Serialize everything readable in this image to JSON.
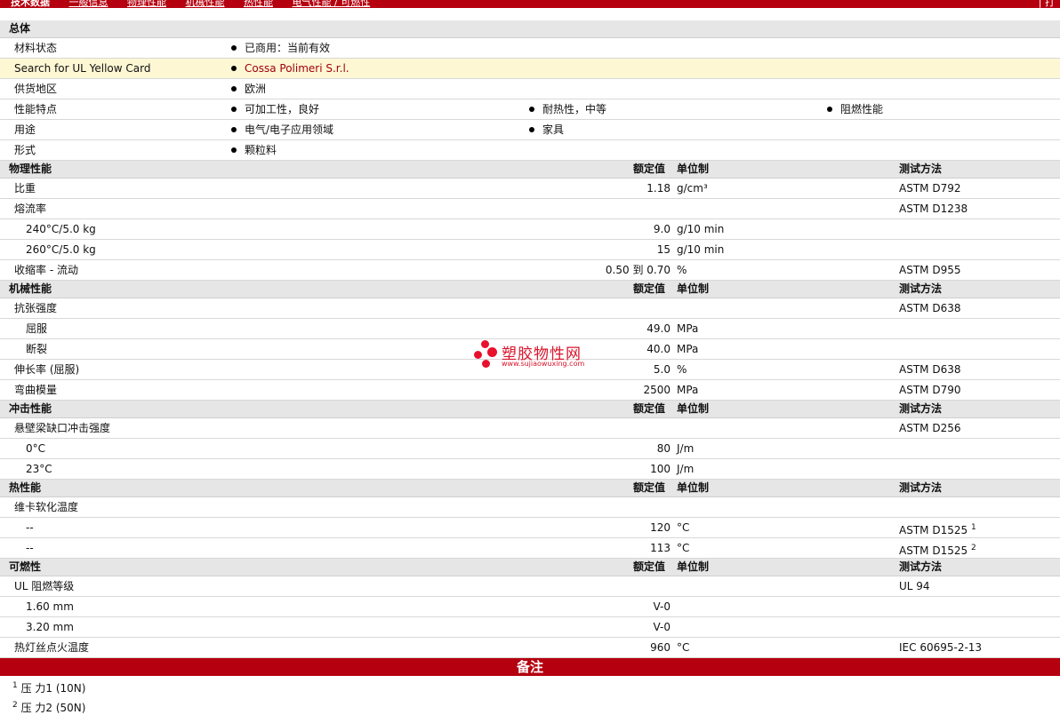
{
  "topnav": {
    "tabs": [
      "技术数据",
      "一般信息",
      "物理性能",
      "机械性能",
      "热性能",
      "电气性能 / 可燃性"
    ],
    "right": "| 打"
  },
  "general": {
    "title": "总体",
    "material_status": {
      "label": "材料状态",
      "value": "已商用：当前有效"
    },
    "yellow_card": {
      "label": "Search for UL Yellow Card",
      "value": "Cossa Polimeri S.r.l."
    },
    "region": {
      "label": "供货地区",
      "value": "欧洲"
    },
    "features": {
      "label": "性能特点",
      "values": [
        "可加工性，良好",
        "耐热性，中等",
        "阻燃性能"
      ]
    },
    "uses": {
      "label": "用途",
      "values": [
        "电气/电子应用领域",
        "家具"
      ]
    },
    "form": {
      "label": "形式",
      "value": "颗粒料"
    }
  },
  "col_headers": {
    "nominal": "额定值",
    "unit": "单位制",
    "test": "测试方法"
  },
  "physical": {
    "title": "物理性能",
    "rows": [
      {
        "label": "比重",
        "value": "1.18",
        "unit": "g/cm³",
        "test": "ASTM D792"
      },
      {
        "label": "熔流率",
        "value": "",
        "unit": "",
        "test": "ASTM D1238"
      },
      {
        "label": "240°C/5.0 kg",
        "value": "9.0",
        "unit": "g/10 min",
        "test": ""
      },
      {
        "label": "260°C/5.0 kg",
        "value": "15",
        "unit": "g/10 min",
        "test": ""
      },
      {
        "label": "收缩率  - 流动",
        "value": "0.50 到  0.70",
        "unit": "%",
        "test": "ASTM D955"
      }
    ]
  },
  "mechanical": {
    "title": "机械性能",
    "rows": [
      {
        "label": "抗张强度",
        "value": "",
        "unit": "",
        "test": "ASTM D638"
      },
      {
        "label": "屈服",
        "value": "49.0",
        "unit": "MPa",
        "test": ""
      },
      {
        "label": "断裂",
        "value": "40.0",
        "unit": "MPa",
        "test": ""
      },
      {
        "label": "伸长率  (屈服)",
        "value": "5.0",
        "unit": "%",
        "test": "ASTM D638"
      },
      {
        "label": "弯曲模量",
        "value": "2500",
        "unit": "MPa",
        "test": "ASTM D790"
      }
    ]
  },
  "impact": {
    "title": "冲击性能",
    "rows": [
      {
        "label": "悬壁梁缺口冲击强度",
        "value": "",
        "unit": "",
        "test": "ASTM D256"
      },
      {
        "label": "0°C",
        "value": "80",
        "unit": "J/m",
        "test": ""
      },
      {
        "label": "23°C",
        "value": "100",
        "unit": "J/m",
        "test": ""
      }
    ]
  },
  "thermal": {
    "title": "热性能",
    "rows": [
      {
        "label": "维卡软化温度",
        "value": "",
        "unit": "",
        "test": ""
      },
      {
        "label": "--",
        "value": "120",
        "unit": "°C",
        "test": "ASTM D1525",
        "note": "1"
      },
      {
        "label": "--",
        "value": "113",
        "unit": "°C",
        "test": "ASTM D1525",
        "note": "2"
      }
    ]
  },
  "flammability": {
    "title": "可燃性",
    "rows": [
      {
        "label": "UL 阻燃等级",
        "value": "",
        "unit": "",
        "test": "UL 94"
      },
      {
        "label": "1.60 mm",
        "value": "V-0",
        "unit": "",
        "test": ""
      },
      {
        "label": "3.20 mm",
        "value": "V-0",
        "unit": "",
        "test": ""
      },
      {
        "label": "热灯丝点火温度",
        "value": "960",
        "unit": "°C",
        "test": "IEC 60695-2-13"
      }
    ]
  },
  "notes": {
    "title": "备注",
    "items": [
      {
        "num": "1",
        "text": "压  力1 (10N)"
      },
      {
        "num": "2",
        "text": "压  力2 (50N)"
      }
    ]
  },
  "watermark": {
    "text": "塑胶物性网",
    "url": "www.sujiaowuxing.com"
  },
  "colors": {
    "accent": "#b5000f",
    "header_bg": "#e6e6e6",
    "highlight_bg": "#fdf7d4",
    "link": "#a2000e"
  }
}
